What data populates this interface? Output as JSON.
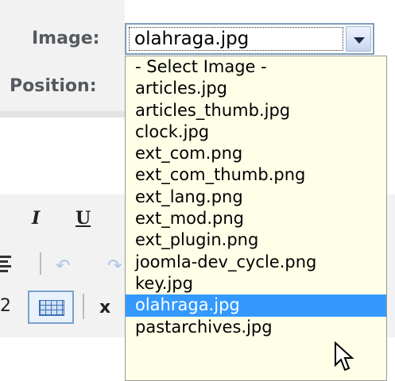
{
  "form": {
    "image_label": "Image:",
    "position_label": "Position:",
    "image_select": {
      "value": "olahraga.jpg",
      "options": [
        "- Select Image -",
        "articles.jpg",
        "articles_thumb.jpg",
        "clock.jpg",
        "ext_com.png",
        "ext_com_thumb.png",
        "ext_lang.png",
        "ext_mod.png",
        "ext_plugin.png",
        "joomla-dev_cycle.png",
        "key.jpg",
        "olahraga.jpg",
        "pastarchives.jpg"
      ],
      "highlighted": "olahraga.jpg"
    }
  },
  "editor_toolbar": {
    "italic": "I",
    "underline": "U",
    "digit": "2",
    "subscript": "x"
  },
  "colors": {
    "dropdown_bg": "#ffffe8",
    "highlight": "#3399ff",
    "label": "#555a60"
  },
  "icons": [
    "chevron-down-icon",
    "undo-icon",
    "redo-icon",
    "align-icon",
    "table-icon",
    "cursor-icon"
  ]
}
